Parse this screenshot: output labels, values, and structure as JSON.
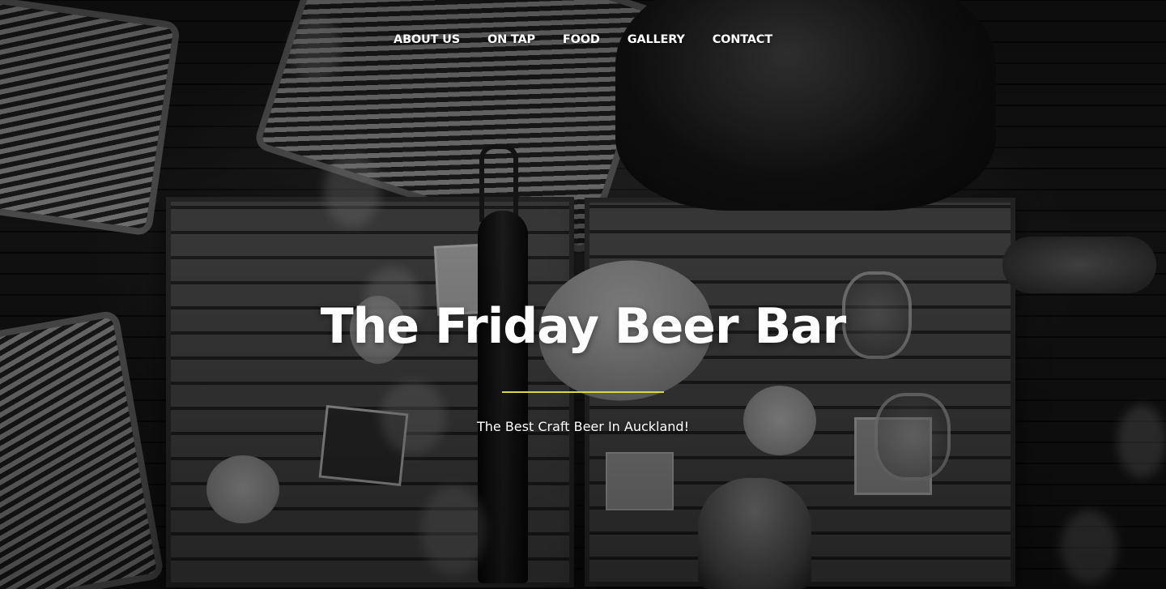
{
  "nav": {
    "items": [
      {
        "label": "ABOUT US"
      },
      {
        "label": "ON TAP"
      },
      {
        "label": "FOOD"
      },
      {
        "label": "GALLERY"
      },
      {
        "label": "CONTACT"
      }
    ]
  },
  "hero": {
    "title": "The Friday Beer Bar",
    "subtitle": "The Best Craft Beer In Auckland!",
    "accent_color": "#d9d84a",
    "background_style": "black-and-white photo of bar tables from above"
  }
}
